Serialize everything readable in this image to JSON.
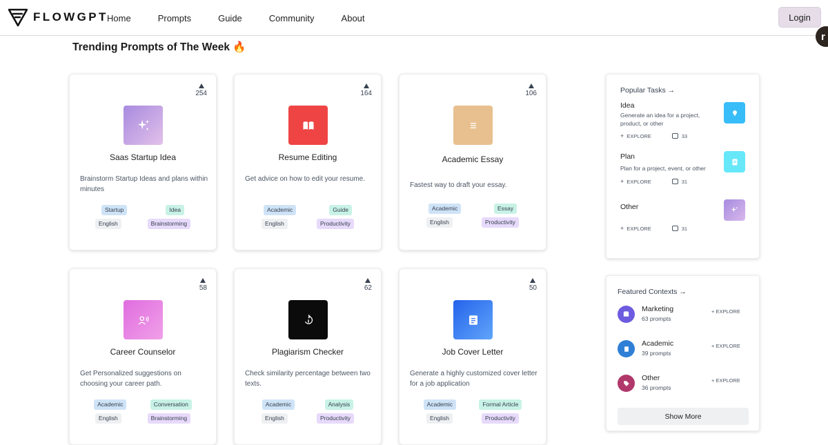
{
  "nav": {
    "logo_text": "FLOWGPT",
    "links": [
      "Home",
      "Prompts",
      "Guide",
      "Community",
      "About"
    ],
    "login_label": "Login",
    "edge_avatar_letter": "r"
  },
  "page": {
    "title": "Trending Prompts of The Week 🔥"
  },
  "cards": [
    {
      "votes": "254",
      "title": "Saas Startup Idea",
      "desc": "Brainstorm Startup Ideas and plans within minutes",
      "tags": [
        [
          "Startup",
          "Idea"
        ],
        [
          "English",
          "Brainstorming"
        ]
      ],
      "icon": "sparkles-icon"
    },
    {
      "votes": "164",
      "title": "Resume Editing",
      "desc": "Get advice on how to edit your resume.",
      "tags": [
        [
          "Academic",
          "Guide"
        ],
        [
          "English",
          "Productivity"
        ]
      ],
      "icon": "open-book-icon"
    },
    {
      "votes": "106",
      "title": "Academic Essay",
      "desc": "Fastest way to draft your essay.",
      "tags": [
        [
          "Academic",
          "Essay"
        ],
        [
          "English",
          "Productivity"
        ]
      ],
      "icon": "document-lines-icon"
    },
    {
      "votes": "58",
      "title": "Career Counselor",
      "desc": "Get Personalized suggestions on choosing your career path.",
      "tags": [
        [
          "Academic",
          "Conversation"
        ],
        [
          "English",
          "Brainstorming"
        ]
      ],
      "icon": "person-voice-icon"
    },
    {
      "votes": "62",
      "title": "Plagiarism Checker",
      "desc": "Check similarity percentage between two texts.",
      "tags": [
        [
          "Academic",
          "Analysis"
        ],
        [
          "English",
          "Productivity"
        ]
      ],
      "icon": "refresh-arrows-icon"
    },
    {
      "votes": "50",
      "title": "Job Cover Letter",
      "desc": "Generate a highly customized cover letter for a job application",
      "tags": [
        [
          "Academic",
          "Formal Article"
        ],
        [
          "English",
          "Productivity"
        ]
      ],
      "icon": "document-icon"
    }
  ],
  "popular_tasks": {
    "heading": "Popular Tasks →",
    "explore_label": "EXPLORE",
    "items": [
      {
        "name": "Idea",
        "desc": "Generate an idea for a project, product, or other",
        "count": "33",
        "icon": "lightbulb-icon",
        "color": "#38bdf8"
      },
      {
        "name": "Plan",
        "desc": "Plan for a project, event, or other",
        "count": "31",
        "icon": "list-icon",
        "color": "#67e8f9"
      },
      {
        "name": "Other",
        "desc": "",
        "count": "31",
        "icon": "sparkles-icon",
        "color": "#c4a7e7"
      }
    ]
  },
  "featured_contexts": {
    "heading": "Featured Contexts →",
    "explore_label": "EXPLORE",
    "items": [
      {
        "name": "Marketing",
        "count": "63 prompts",
        "icon": "store-icon",
        "color": "#6d5be0"
      },
      {
        "name": "Academic",
        "count": "39 prompts",
        "icon": "book-icon",
        "color": "#2f7fd6"
      },
      {
        "name": "Other",
        "count": "36 prompts",
        "icon": "tag-icon",
        "color": "#b0386a"
      }
    ],
    "show_more_label": "Show More"
  }
}
